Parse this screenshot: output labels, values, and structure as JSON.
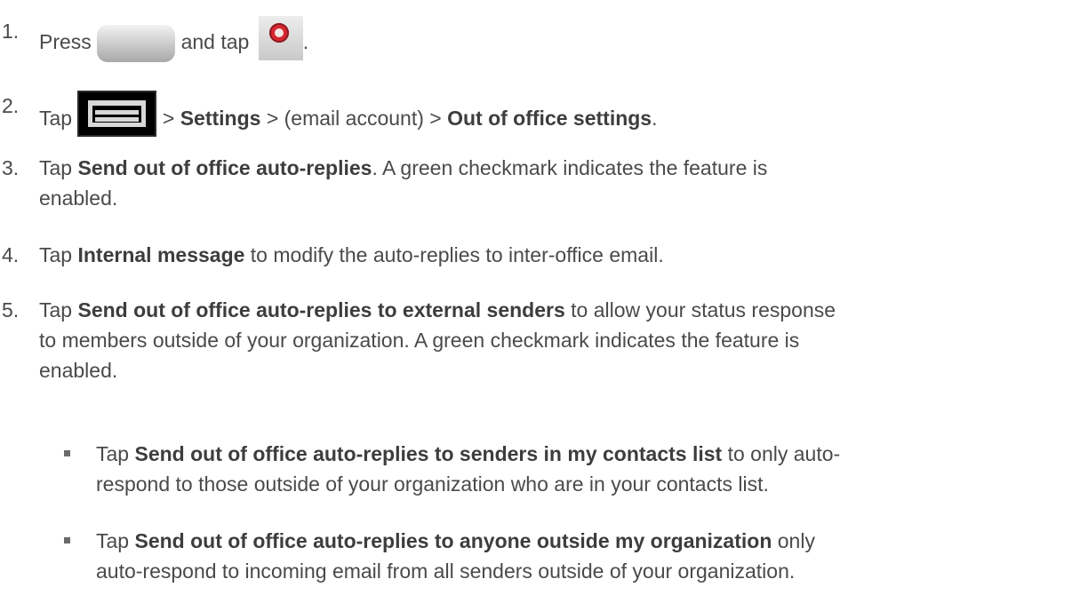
{
  "steps": [
    {
      "number": "1.",
      "text": {
        "a": "Press ",
        "b": " and tap ",
        "c": "."
      },
      "icons": [
        "home-key-icon",
        "email-app-icon"
      ]
    },
    {
      "number": "2.",
      "text": {
        "a": "Tap ",
        "b": " > ",
        "c": "Settings",
        "d": " > (email account) > ",
        "e": "Out of office settings",
        "f": "."
      },
      "icons": [
        "menu-key-icon"
      ]
    },
    {
      "number": "3.",
      "text": {
        "a": "Tap ",
        "b": "Send out of office auto-replies",
        "c": ". A green checkmark indicates the feature is",
        "d": "enabled."
      }
    },
    {
      "number": "4.",
      "text": {
        "a": "Tap ",
        "b": "Internal message",
        "c": " to modify the auto-replies to inter-office email."
      }
    },
    {
      "number": "5.",
      "text": {
        "a": "Tap ",
        "b": "Send out of office auto-replies to external senders",
        "c": " to allow your status response",
        "d": "to members outside of your organization. A green checkmark indicates the feature is",
        "e": "enabled."
      }
    }
  ],
  "substeps": [
    {
      "text": {
        "a": "Tap ",
        "b": "Send out of office auto-replies to senders in my contacts list",
        "c": " to only auto-",
        "d": "respond to those outside of your organization who are in your contacts list."
      }
    },
    {
      "text": {
        "a": "Tap ",
        "b": "Send out of office auto-replies to anyone outside my organization",
        "c": " only",
        "d": "auto-respond to incoming email from all senders outside of your organization."
      }
    }
  ]
}
